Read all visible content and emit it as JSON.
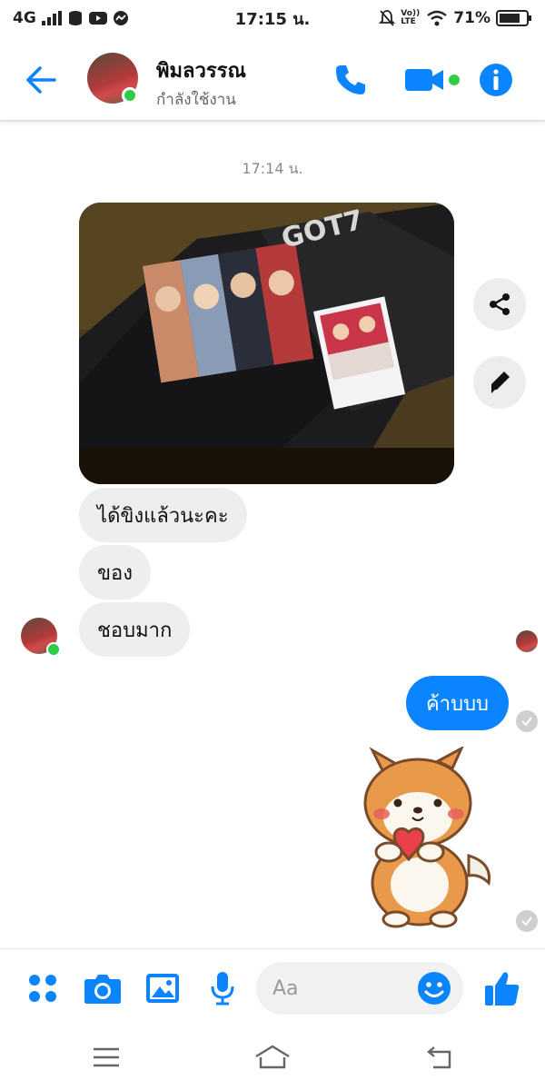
{
  "status_bar": {
    "network": "4G",
    "time": "17:15 น.",
    "lte": "Vo)) LTE",
    "battery": "71%"
  },
  "header": {
    "contact_name": "พิมลวรรณ",
    "contact_status": "กำลังใช้งาน"
  },
  "conversation": {
    "timestamp": "17:14 น.",
    "incoming": [
      {
        "text": "ได้ขิงแล้วนะคะ"
      },
      {
        "text": "ของ"
      },
      {
        "text": "ชอบมาก"
      }
    ],
    "outgoing_text": "ค้าบบบ",
    "photo_label": "GOT7"
  },
  "composer": {
    "placeholder": "Aa"
  },
  "colors": {
    "accent": "#0b84ff",
    "presence": "#31cc46",
    "bubble_incoming": "#eeeeee"
  },
  "icons": {
    "header": [
      "back-arrow-icon",
      "phone-icon",
      "video-call-icon",
      "info-icon"
    ],
    "side": [
      "share-icon",
      "edit-icon"
    ],
    "composer": [
      "menu-dots-icon",
      "camera-icon",
      "gallery-icon",
      "microphone-icon",
      "emoji-icon",
      "thumbs-up-icon"
    ],
    "nav": [
      "recent-apps-icon",
      "home-icon",
      "back-icon"
    ]
  }
}
